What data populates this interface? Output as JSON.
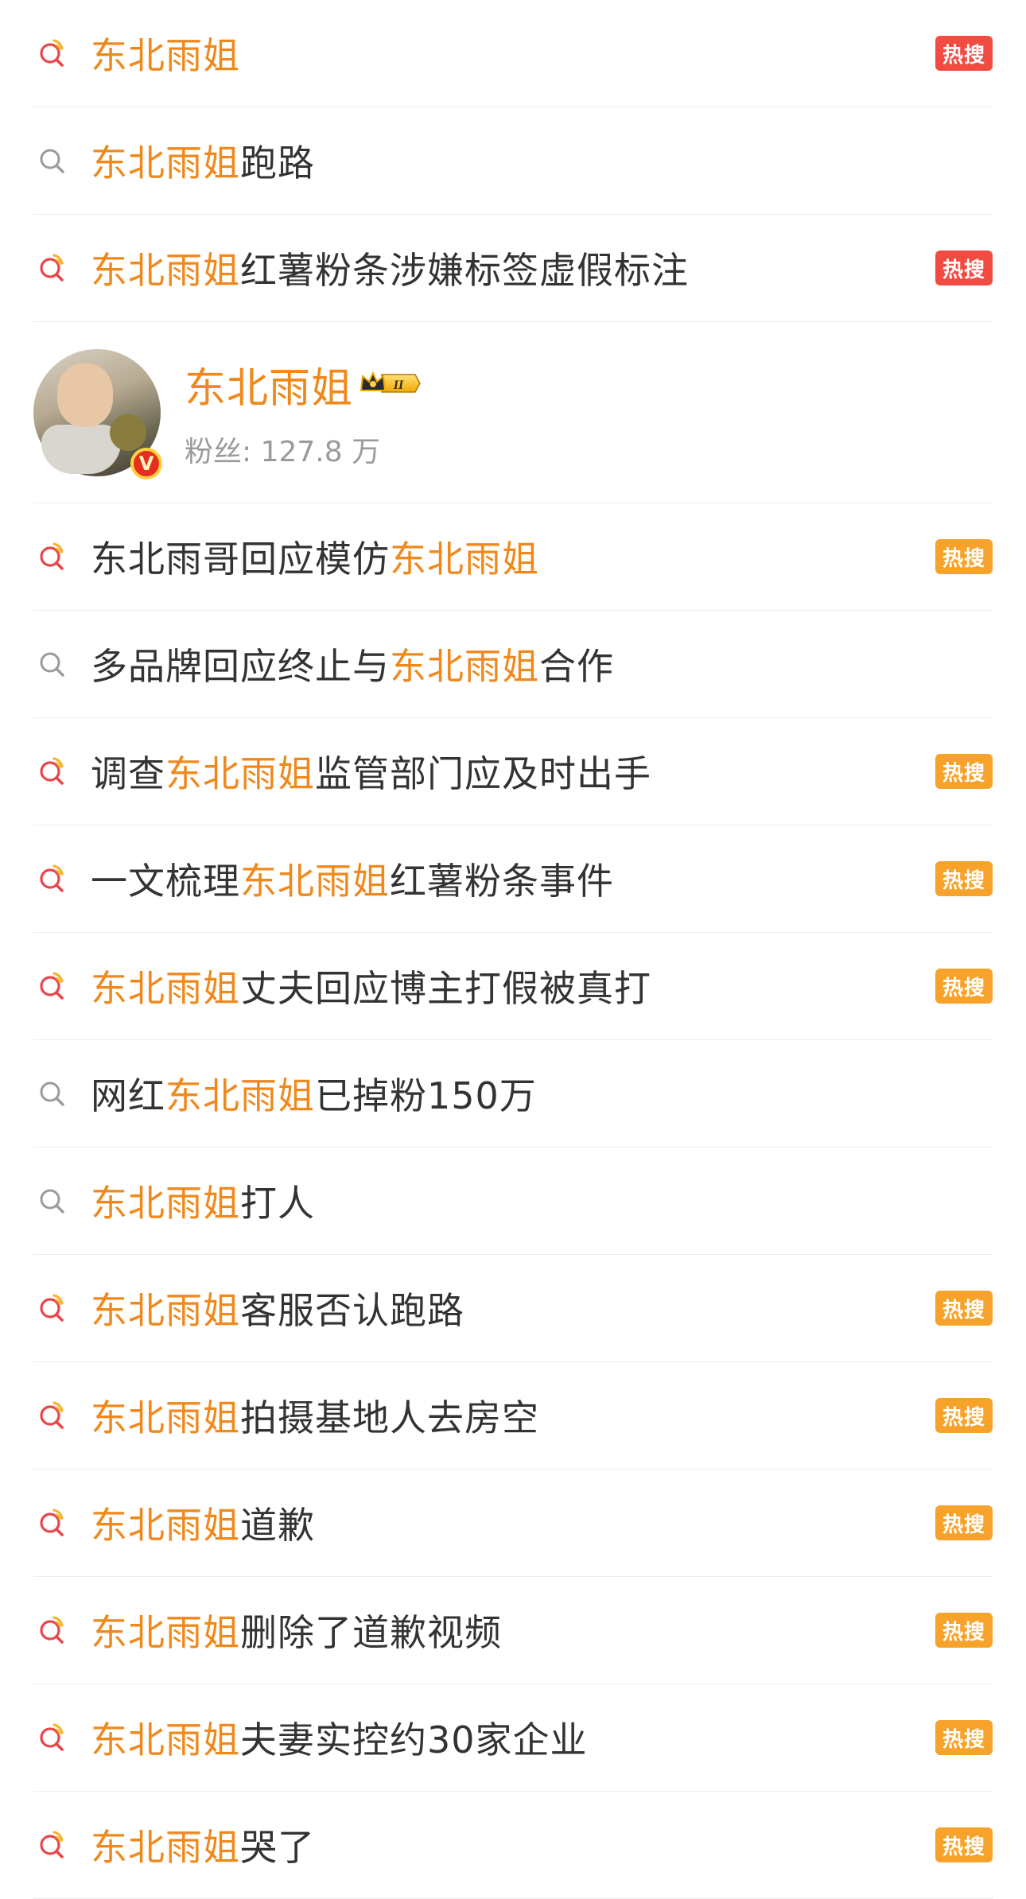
{
  "colors": {
    "keyword": "#f0891c",
    "text": "#333333",
    "hot_red": "#f24b42",
    "hot_orange": "#f7a32b",
    "icon_hot_ring": "#e9464b",
    "icon_hot_spark": "#f7b32b",
    "icon_gray": "#9b9b9b"
  },
  "keyword": "东北雨姐",
  "suggestions_top": [
    {
      "icon": "hot-search-icon",
      "parts": [
        {
          "t": "东北雨姐",
          "kw": true
        }
      ],
      "badge": "热搜",
      "badge_color": "red"
    },
    {
      "icon": "search-icon",
      "parts": [
        {
          "t": "东北雨姐",
          "kw": true
        },
        {
          "t": "跑路",
          "kw": false
        }
      ],
      "badge": null
    },
    {
      "icon": "hot-search-icon",
      "parts": [
        {
          "t": "东北雨姐",
          "kw": true
        },
        {
          "t": "红薯粉条涉嫌标签虚假标注",
          "kw": false
        }
      ],
      "badge": "热搜",
      "badge_color": "red"
    }
  ],
  "user": {
    "name": "东北雨姐",
    "level_badge": "II",
    "fans_label": "粉丝:",
    "fans_count": "127.8 万",
    "verified_mark": "V"
  },
  "suggestions_bottom": [
    {
      "icon": "hot-search-icon",
      "parts": [
        {
          "t": "东北雨哥回应模仿",
          "kw": false
        },
        {
          "t": "东北雨姐",
          "kw": true
        }
      ],
      "badge": "热搜",
      "badge_color": "orange"
    },
    {
      "icon": "search-icon",
      "parts": [
        {
          "t": "多品牌回应终止与",
          "kw": false
        },
        {
          "t": "东北雨姐",
          "kw": true
        },
        {
          "t": "合作",
          "kw": false
        }
      ],
      "badge": null
    },
    {
      "icon": "hot-search-icon",
      "parts": [
        {
          "t": "调查",
          "kw": false
        },
        {
          "t": "东北雨姐",
          "kw": true
        },
        {
          "t": "监管部门应及时出手",
          "kw": false
        }
      ],
      "badge": "热搜",
      "badge_color": "orange"
    },
    {
      "icon": "hot-search-icon",
      "parts": [
        {
          "t": "一文梳理",
          "kw": false
        },
        {
          "t": "东北雨姐",
          "kw": true
        },
        {
          "t": "红薯粉条事件",
          "kw": false
        }
      ],
      "badge": "热搜",
      "badge_color": "orange"
    },
    {
      "icon": "hot-search-icon",
      "parts": [
        {
          "t": "东北雨姐",
          "kw": true
        },
        {
          "t": "丈夫回应博主打假被真打",
          "kw": false
        }
      ],
      "badge": "热搜",
      "badge_color": "orange"
    },
    {
      "icon": "search-icon",
      "parts": [
        {
          "t": "网红",
          "kw": false
        },
        {
          "t": "东北雨姐",
          "kw": true
        },
        {
          "t": "已掉粉150万",
          "kw": false
        }
      ],
      "badge": null
    },
    {
      "icon": "search-icon",
      "parts": [
        {
          "t": "东北雨姐",
          "kw": true
        },
        {
          "t": "打人",
          "kw": false
        }
      ],
      "badge": null
    },
    {
      "icon": "hot-search-icon",
      "parts": [
        {
          "t": "东北雨姐",
          "kw": true
        },
        {
          "t": "客服否认跑路",
          "kw": false
        }
      ],
      "badge": "热搜",
      "badge_color": "orange"
    },
    {
      "icon": "hot-search-icon",
      "parts": [
        {
          "t": "东北雨姐",
          "kw": true
        },
        {
          "t": "拍摄基地人去房空",
          "kw": false
        }
      ],
      "badge": "热搜",
      "badge_color": "orange"
    },
    {
      "icon": "hot-search-icon",
      "parts": [
        {
          "t": "东北雨姐",
          "kw": true
        },
        {
          "t": "道歉",
          "kw": false
        }
      ],
      "badge": "热搜",
      "badge_color": "orange"
    },
    {
      "icon": "hot-search-icon",
      "parts": [
        {
          "t": "东北雨姐",
          "kw": true
        },
        {
          "t": "删除了道歉视频",
          "kw": false
        }
      ],
      "badge": "热搜",
      "badge_color": "orange"
    },
    {
      "icon": "hot-search-icon",
      "parts": [
        {
          "t": "东北雨姐",
          "kw": true
        },
        {
          "t": "夫妻实控约30家企业",
          "kw": false
        }
      ],
      "badge": "热搜",
      "badge_color": "orange"
    },
    {
      "icon": "hot-search-icon",
      "parts": [
        {
          "t": "东北雨姐",
          "kw": true
        },
        {
          "t": "哭了",
          "kw": false
        }
      ],
      "badge": "热搜",
      "badge_color": "orange"
    }
  ]
}
